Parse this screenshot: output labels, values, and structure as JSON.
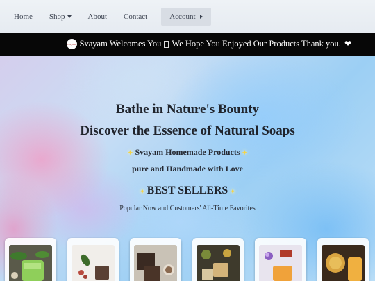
{
  "nav": {
    "items": [
      {
        "label": "Home"
      },
      {
        "label": "Shop"
      },
      {
        "label": "About"
      },
      {
        "label": "Contact"
      },
      {
        "label": "Account"
      }
    ]
  },
  "marquee": {
    "text_a": "Svayam Welcomes You",
    "text_b": "We Hope You Enjoyed Our Products Thank you."
  },
  "hero": {
    "headline1": "Bathe in Nature's Bounty",
    "headline2": "Discover the Essence of Natural Soaps",
    "sub1": "Svayam Homemade Products",
    "sub2": "pure and Handmade with Love",
    "best_sellers": "BEST SELLERS",
    "popular": "Popular Now and Customers' All-Time Favorites"
  },
  "products": [
    {
      "image": "green-soap-with-leaves"
    },
    {
      "image": "white-soap-with-berries"
    },
    {
      "image": "charcoal-soap-bars"
    },
    {
      "image": "herbal-soap-with-flowers"
    },
    {
      "image": "orange-soap-with-lavender"
    },
    {
      "image": "honey-soap-with-jar"
    }
  ],
  "colors": {
    "marquee_bg": "#070707",
    "nav_bg": "#eef2f6",
    "spark": "#f2d34a"
  }
}
